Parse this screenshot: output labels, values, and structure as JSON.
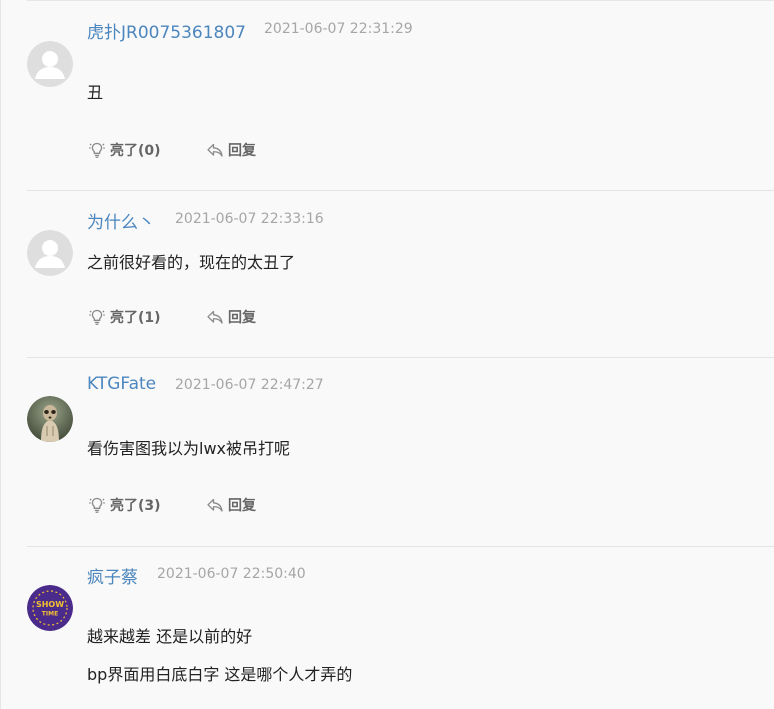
{
  "comments": [
    {
      "username": "虎扑JR0075361807",
      "time": "2021-06-07 22:31:29",
      "lines": [
        "丑"
      ],
      "like_label": "亮了(0)",
      "reply_label": "回复",
      "avatar_icon": "default-user-avatar-icon"
    },
    {
      "username": "为什么丶",
      "time": "2021-06-07 22:33:16",
      "lines": [
        "之前很好看的，现在的太丑了"
      ],
      "like_label": "亮了(1)",
      "reply_label": "回复",
      "avatar_icon": "default-user-avatar-icon"
    },
    {
      "username": "KTGFate",
      "time": "2021-06-07 22:47:27",
      "lines": [
        "看伤害图我以为lwx被吊打呢"
      ],
      "like_label": "亮了(3)",
      "reply_label": "回复",
      "avatar_icon": "meerkat-photo-avatar"
    },
    {
      "username": "疯子蔡",
      "time": "2021-06-07 22:50:40",
      "lines": [
        "越来越差 还是以前的好",
        "bp界面用白底白字 这是哪个人才弄的"
      ],
      "avatar_icon": "show-time-badge-avatar"
    }
  ],
  "colors": {
    "username": "#4b86be",
    "timestamp": "#a6a6a6",
    "content": "#222222",
    "action": "#666666",
    "background": "#f9f9f9"
  }
}
